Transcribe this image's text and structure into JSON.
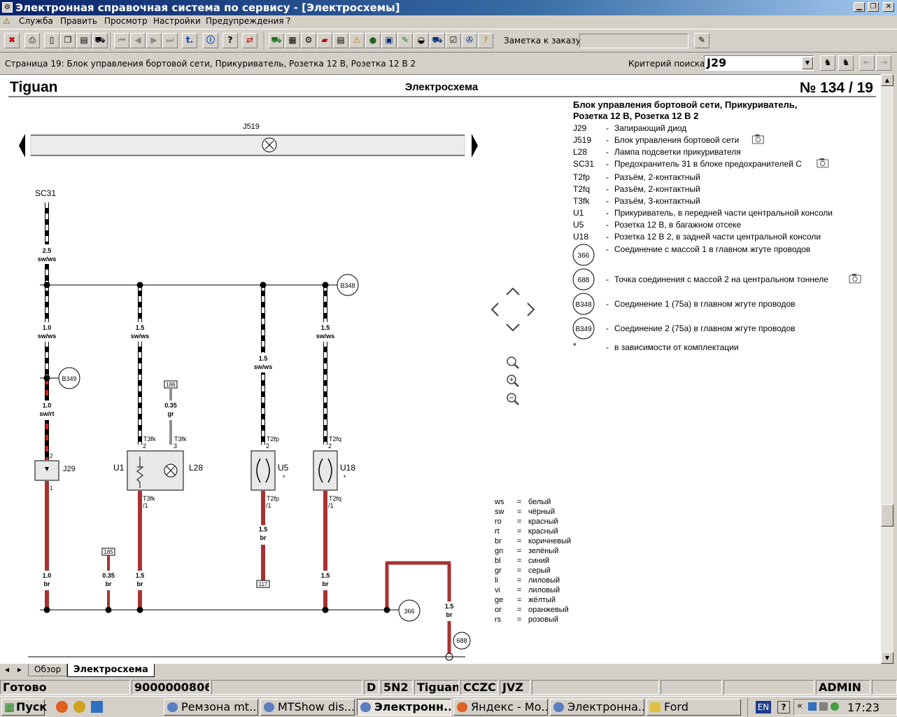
{
  "window": {
    "title": "Электронная справочная система по сервису - [Электросхемы]",
    "min": "▁",
    "max": "❐",
    "close": "✕"
  },
  "menu": [
    "Служба",
    "Править",
    "Просмотр",
    "Настройки",
    "Предупреждения",
    "?"
  ],
  "toolbar": {
    "order_note_label": "Заметка к заказу:",
    "order_note_value": ""
  },
  "pagebar": {
    "page_info": "Страница 19: Блок управления бортовой сети, Прикуриватель, Розетка 12 В, Розетка 12 В 2",
    "search_label": "Критерий поиска:",
    "search_value": "J29"
  },
  "diagram": {
    "model": "Tiguan",
    "heading": "Электросхема",
    "number": "№  134 / 19",
    "legend_title": "Блок управления бортовой сети, Прикуриватель, Розетка 12 В, Розетка 12 В 2",
    "components": [
      {
        "code": "J29",
        "desc": "Запирающий диод",
        "photo": false
      },
      {
        "code": "J519",
        "desc": "Блок управления бортовой сети",
        "photo": true
      },
      {
        "code": "L28",
        "desc": "Лампа подсветки прикуривателя",
        "photo": false
      },
      {
        "code": "SC31",
        "desc": "Предохранитель 31 в блоке предохранителей C",
        "photo": true
      },
      {
        "code": "T2fp",
        "desc": "Разъём, 2-контактный",
        "photo": false
      },
      {
        "code": "T2fq",
        "desc": "Разъём, 2-контактный",
        "photo": false
      },
      {
        "code": "T3fk",
        "desc": "Разъём, 3-контактный",
        "photo": false
      },
      {
        "code": "U1",
        "desc": "Прикуриватель, в передней части центральной консоли",
        "photo": false
      },
      {
        "code": "U5",
        "desc": "Розетка 12 В, в багажном отсеке",
        "photo": false
      },
      {
        "code": "U18",
        "desc": "Розетка 12 В 2, в задней части центральной консоли",
        "photo": false
      }
    ],
    "connections": [
      {
        "code": "366",
        "desc": "Соединение с массой 1 в главном жгуте проводов",
        "photo": false
      },
      {
        "code": "688",
        "desc": "Точка соединения с массой 2 на центральном тоннеле",
        "photo": true
      },
      {
        "code": "B348",
        "desc": "Соединение 1 (75a) в главном жгуте проводов",
        "photo": false
      },
      {
        "code": "B349",
        "desc": "Соединение 2 (75a) в главном жгуте проводов",
        "photo": false
      }
    ],
    "footnote": {
      "code": "*",
      "desc": "в зависимости от комплектации"
    },
    "colors": [
      {
        "code": "ws",
        "name": "белый"
      },
      {
        "code": "sw",
        "name": "чёрный"
      },
      {
        "code": "ro",
        "name": "красный"
      },
      {
        "code": "rt",
        "name": "красный"
      },
      {
        "code": "br",
        "name": "коричневый"
      },
      {
        "code": "gn",
        "name": "зелёный"
      },
      {
        "code": "bl",
        "name": "синий"
      },
      {
        "code": "gr",
        "name": "серый"
      },
      {
        "code": "li",
        "name": "лиловый"
      },
      {
        "code": "vi",
        "name": "лиловый"
      },
      {
        "code": "ge",
        "name": "жёлтый"
      },
      {
        "code": "or",
        "name": "оранжевый"
      },
      {
        "code": "rs",
        "name": "розовый"
      }
    ],
    "labels": {
      "j519": "J519",
      "sc31": "SC31",
      "j29": "J29",
      "u1": "U1",
      "l28": "L28",
      "u5": "U5",
      "u18": "U18",
      "w_sc31_size": "2.5",
      "w_sc31_color": "sw/ws",
      "w1_size": "1.0",
      "w1_color": "sw/ws",
      "w1b_size": "1.0",
      "w1b_color": "sw/rt",
      "w2_size": "1.5",
      "w2_color": "sw/ws",
      "w3_size": "1.5",
      "w3_color": "sw/ws",
      "w4_size": "1.5",
      "w4_color": "sw/ws",
      "w_gr_size": "0.35",
      "w_gr_color": "gr",
      "w_br1_size": "1.0",
      "w_br1_color": "br",
      "w_br2_size": "0.35",
      "w_br2_color": "br",
      "w_br3_size": "1.5",
      "w_br3_color": "br",
      "w_br4_size": "1.5",
      "w_br4_color": "br",
      "w_br4b_size": "1.5",
      "w_br4b_color": "br",
      "w_br5_size": "1.5",
      "w_br5_color": "br",
      "w_br6_size": "1.5",
      "w_br6_color": "br",
      "ref186": "186",
      "ref185": "185",
      "ref117": "117",
      "b348": "B348",
      "b349": "B349",
      "c366": "366",
      "c688": "688",
      "t3fk_a": "T3fk",
      "t3fk_b": "T3fk",
      "t3fk_c": "T3fk",
      "t2fp_a": "T2fp",
      "t2fp_b": "T2fp",
      "t2fq_a": "T2fq",
      "t2fq_b": "T2fq",
      "pin2": "2",
      "pin3": "3",
      "pin1": "1",
      "slash1": "/1",
      "star": "*"
    },
    "wire_colors": {
      "black": "#000000",
      "white": "#ffffff",
      "brown": "#a83232",
      "red": "#d92020",
      "grey": "#909090"
    }
  },
  "tabs": {
    "overview": "Обзор",
    "diagram": "Электросхема"
  },
  "status": {
    "ready": "Готово",
    "order": "9000000806",
    "s1": "D",
    "s2": "5N2",
    "model": "Tiguan",
    "engine": "CCZC",
    "gearbox": "JVZ",
    "user": "ADMIN"
  },
  "taskbar": {
    "start": "Пуск",
    "tasks": [
      "Ремзона mt...",
      "MTShow dis...",
      "Электронн...",
      "Яндекс - Мо...",
      "Электронна...",
      "Ford"
    ],
    "lang": "EN",
    "help": "?",
    "clock": "17:23"
  }
}
